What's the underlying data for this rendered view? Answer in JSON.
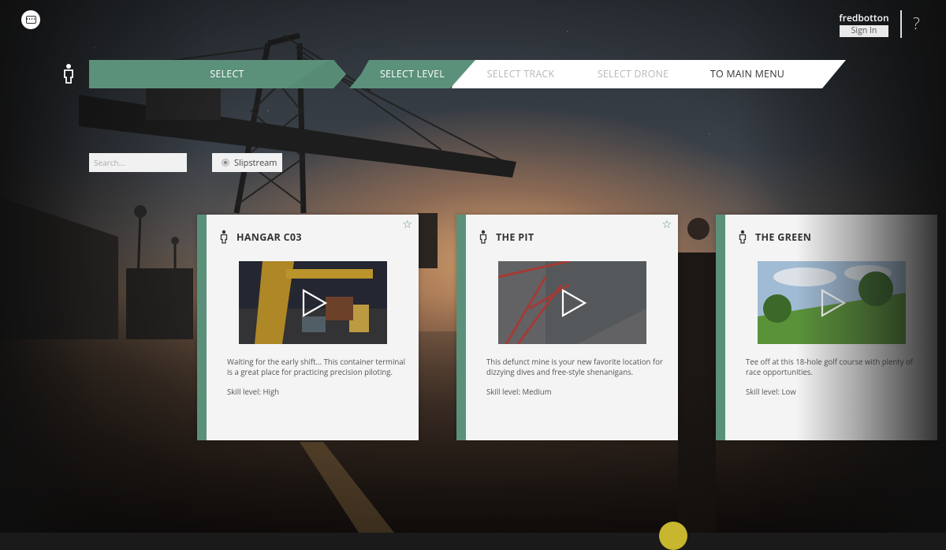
{
  "user": {
    "name": "fredbotton",
    "sign_in_label": "Sign In"
  },
  "help_label": "?",
  "icons": {
    "menu": "keyboard-icon",
    "pilot": "pilot-icon",
    "favorite": "star-outline-icon",
    "play": "play-icon"
  },
  "colors": {
    "accent": "#5b917a",
    "card_bg": "#f4f4f4",
    "nav_inactive": "#b8b8b8"
  },
  "nav": {
    "steps": [
      {
        "label": "SELECT",
        "state": "done"
      },
      {
        "label": "SELECT LEVEL",
        "state": "active"
      },
      {
        "label": "SELECT TRACK",
        "state": "disabled"
      },
      {
        "label": "SELECT DRONE",
        "state": "disabled"
      },
      {
        "label": "TO MAIN MENU",
        "state": "link"
      }
    ]
  },
  "filters": {
    "search_placeholder": "Search...",
    "search_value": "",
    "slipstream_label": "Slipstream"
  },
  "levels": [
    {
      "title": "HANGAR C03",
      "description": "Waiting for the early shift... This container terminal is a great place for practicing precision piloting.",
      "skill": "Skill level: High",
      "favorite": true
    },
    {
      "title": "THE PIT",
      "description": "This defunct mine is your new favorite location for dizzying dives and free-style shenanigans.",
      "skill": "Skill level: Medium",
      "favorite": true
    },
    {
      "title": "THE GREEN",
      "description": "Tee off at this 18-hole golf course with plenty of race opportunities.",
      "skill": "Skill level: Low",
      "favorite": false
    }
  ]
}
